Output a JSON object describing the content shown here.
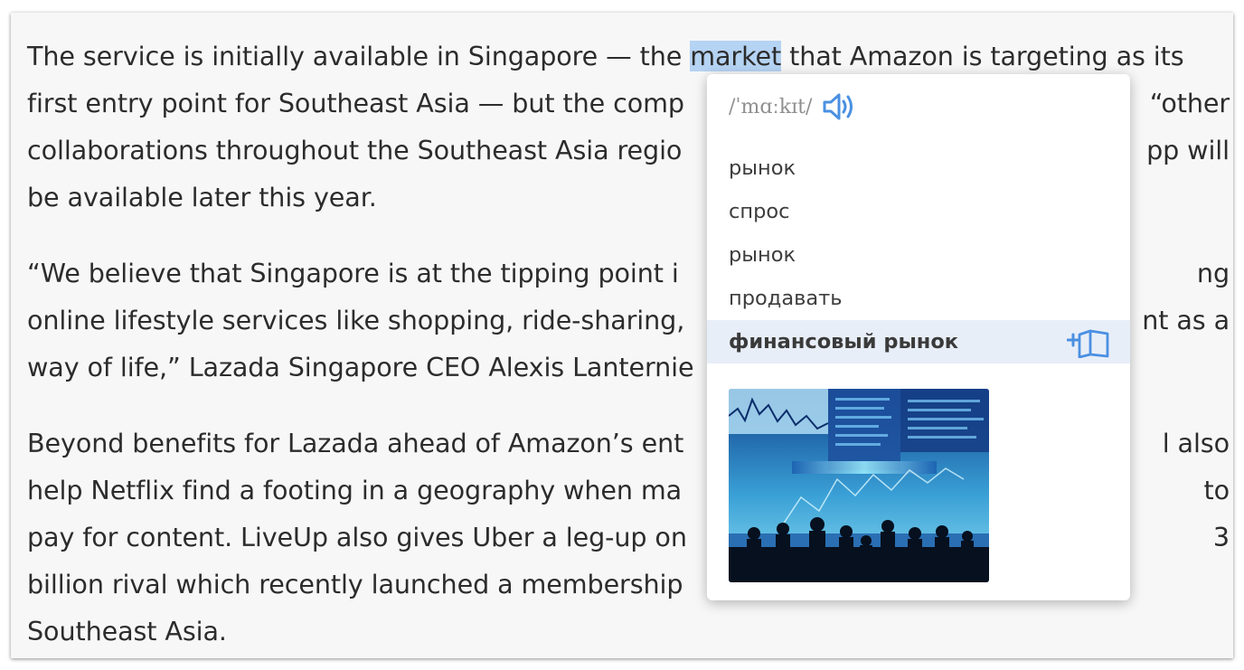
{
  "article": {
    "p1": [
      {
        "before": "The service is initially available in Singapore — the ",
        "highlight": "market",
        "after": " that Amazon is targeting as its"
      },
      {
        "text": "first entry point for Southeast Asia — but the comp",
        "tail": "“other"
      },
      {
        "text": "collaborations throughout the Southeast Asia regio",
        "tail": "pp will"
      },
      {
        "text": "be available later this year.",
        "tail": ""
      }
    ],
    "p2": [
      {
        "text": "“We believe that Singapore is at the tipping point i",
        "tail": "ng"
      },
      {
        "text": "online lifestyle services like shopping, ride-sharing,",
        "tail": "nt as a"
      },
      {
        "text": "way of life,” Lazada Singapore CEO Alexis Lanternie",
        "tail": ""
      }
    ],
    "p3": [
      {
        "text": "Beyond benefits for Lazada ahead of Amazon’s ent",
        "tail": "l also"
      },
      {
        "text": "help Netflix find a footing in a geography when ma",
        "tail": "to"
      },
      {
        "text": "pay for content. LiveUp also gives Uber a leg-up on",
        "tail": "3"
      },
      {
        "text": "billion rival which recently launched a membership",
        "tail": ""
      },
      {
        "text": "Southeast Asia.",
        "tail": ""
      }
    ]
  },
  "popup": {
    "transcription": "/ˈmɑːkɪt/",
    "speaker_icon": "speaker-icon",
    "translations": [
      "рынок",
      "спрос",
      "рынок",
      "продавать",
      "финансовый рынок"
    ],
    "active_index": 4,
    "add_icon": "add-to-dictionary-icon",
    "accent_color": "#4a90e2",
    "active_bg": "#e8eef8",
    "image_icon": "stock-market-image"
  }
}
